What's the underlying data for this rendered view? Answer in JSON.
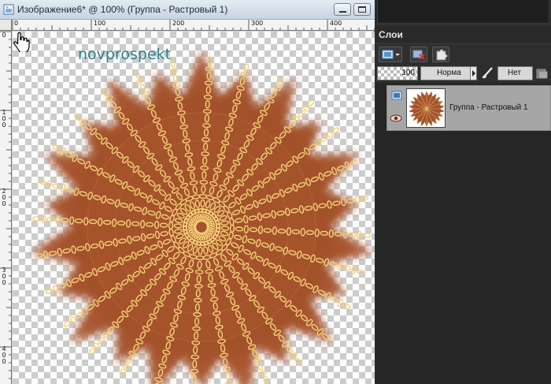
{
  "image_window": {
    "title": "Изображение6* @ 100% (Группа - Растровый 1)",
    "minimize_icon": "minimize-icon",
    "maximize_icon": "restore-icon"
  },
  "rulers": {
    "top_labels": [
      "0",
      "100",
      "200",
      "300",
      "400"
    ],
    "left_labels": [
      "0",
      "1 0 0",
      "2 0 0",
      "3 0 0",
      "4 0 0"
    ]
  },
  "canvas": {
    "watermark": "novprospekt",
    "main_color": "#a4522c",
    "chain_color": "#f4cf7a",
    "cursor_icon": "hand-cursor-icon"
  },
  "layers_panel": {
    "title": "Слои",
    "toolbar": {
      "new_layer_icon": "new-layer-icon",
      "delete_layer_icon": "delete-layer-icon",
      "mask_icon": "puzzle-mask-icon"
    },
    "opacity": "100",
    "blend_mode": "Норма",
    "lock_mode": "Нет",
    "layers": [
      {
        "name": "Группа - Растровый 1",
        "visible": true
      }
    ]
  },
  "colors": {
    "panel_bg": "#2a2a2a",
    "selected_layer_bg": "#a6a6a6",
    "titlebar": "#d3dde9"
  }
}
